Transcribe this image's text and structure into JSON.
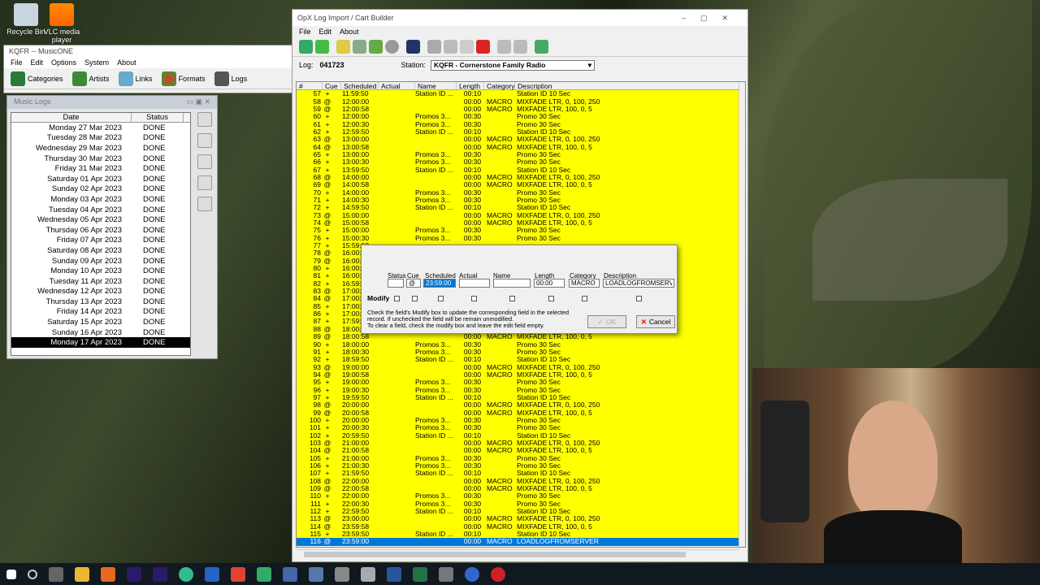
{
  "desktop": {
    "icons": [
      {
        "label": "Recycle Bin",
        "icon": "recycle-bin-icon"
      },
      {
        "label": "VLC media player",
        "icon": "vlc-icon"
      }
    ]
  },
  "musicone": {
    "title": "KQFR -- MusicONE",
    "menu": [
      "File",
      "Edit",
      "Options",
      "System",
      "About"
    ],
    "toolbar": [
      "Categories",
      "Artists",
      "Links",
      "Formats",
      "Logs"
    ]
  },
  "musiclogs": {
    "title": "Music Logs",
    "columns": [
      "Date",
      "Status"
    ],
    "rows": [
      {
        "date": "Monday 27 Mar 2023",
        "status": "DONE"
      },
      {
        "date": "Tuesday 28 Mar 2023",
        "status": "DONE"
      },
      {
        "date": "Wednesday 29 Mar 2023",
        "status": "DONE"
      },
      {
        "date": "Thursday 30 Mar 2023",
        "status": "DONE"
      },
      {
        "date": "Friday 31 Mar 2023",
        "status": "DONE"
      },
      {
        "date": "Saturday 01 Apr 2023",
        "status": "DONE"
      },
      {
        "date": "Sunday 02 Apr 2023",
        "status": "DONE"
      },
      {
        "date": "Monday 03 Apr 2023",
        "status": "DONE"
      },
      {
        "date": "Tuesday 04 Apr 2023",
        "status": "DONE"
      },
      {
        "date": "Wednesday 05 Apr 2023",
        "status": "DONE"
      },
      {
        "date": "Thursday 06 Apr 2023",
        "status": "DONE"
      },
      {
        "date": "Friday 07 Apr 2023",
        "status": "DONE"
      },
      {
        "date": "Saturday 08 Apr 2023",
        "status": "DONE"
      },
      {
        "date": "Sunday 09 Apr 2023",
        "status": "DONE"
      },
      {
        "date": "Monday 10 Apr 2023",
        "status": "DONE"
      },
      {
        "date": "Tuesday 11 Apr 2023",
        "status": "DONE"
      },
      {
        "date": "Wednesday 12 Apr 2023",
        "status": "DONE"
      },
      {
        "date": "Thursday 13 Apr 2023",
        "status": "DONE"
      },
      {
        "date": "Friday 14 Apr 2023",
        "status": "DONE"
      },
      {
        "date": "Saturday 15 Apr 2023",
        "status": "DONE"
      },
      {
        "date": "Sunday 16 Apr 2023",
        "status": "DONE"
      },
      {
        "date": "Monday 17 Apr 2023",
        "status": "DONE"
      }
    ],
    "selected_index": 21
  },
  "opx": {
    "title": "OpX Log Import / Cart Builder",
    "menu": [
      "File",
      "Edit",
      "About"
    ],
    "log_label": "Log:",
    "log_value": "041723",
    "station_label": "Station:",
    "station_value": "KQFR - Cornerstone Family Radio",
    "columns": [
      "#",
      "Cue",
      "Scheduled",
      "Actual",
      "Name",
      "Length",
      "Category",
      "Description"
    ],
    "rows": [
      [
        "57",
        "+",
        "11:59:50",
        "",
        "Station ID ...",
        "00:10",
        "",
        "Station ID 10 Sec"
      ],
      [
        "58",
        "@",
        "12:00:00",
        "",
        "",
        "00:00",
        "MACRO",
        "MIXFADE LTR, 0, 100, 250"
      ],
      [
        "59",
        "@",
        "12:00:58",
        "",
        "",
        "00:00",
        "MACRO",
        "MIXFADE LTR, 100, 0, 5"
      ],
      [
        "60",
        "+",
        "12:00:00",
        "",
        "Promos 3...",
        "00:30",
        "",
        "Promo 30 Sec"
      ],
      [
        "61",
        "+",
        "12:00:30",
        "",
        "Promos 3...",
        "00:30",
        "",
        "Promo 30 Sec"
      ],
      [
        "62",
        "+",
        "12:59:50",
        "",
        "Station ID ...",
        "00:10",
        "",
        "Station ID 10 Sec"
      ],
      [
        "63",
        "@",
        "13:00:00",
        "",
        "",
        "00:00",
        "MACRO",
        "MIXFADE LTR, 0, 100, 250"
      ],
      [
        "64",
        "@",
        "13:00:58",
        "",
        "",
        "00:00",
        "MACRO",
        "MIXFADE LTR, 100, 0, 5"
      ],
      [
        "65",
        "+",
        "13:00:00",
        "",
        "Promos 3...",
        "00:30",
        "",
        "Promo 30 Sec"
      ],
      [
        "66",
        "+",
        "13:00:30",
        "",
        "Promos 3...",
        "00:30",
        "",
        "Promo 30 Sec"
      ],
      [
        "67",
        "+",
        "13:59:50",
        "",
        "Station ID ...",
        "00:10",
        "",
        "Station ID 10 Sec"
      ],
      [
        "68",
        "@",
        "14:00:00",
        "",
        "",
        "00:00",
        "MACRO",
        "MIXFADE LTR, 0, 100, 250"
      ],
      [
        "69",
        "@",
        "14:00:58",
        "",
        "",
        "00:00",
        "MACRO",
        "MIXFADE LTR, 100, 0, 5"
      ],
      [
        "70",
        "+",
        "14:00:00",
        "",
        "Promos 3...",
        "00:30",
        "",
        "Promo 30 Sec"
      ],
      [
        "71",
        "+",
        "14:00:30",
        "",
        "Promos 3...",
        "00:30",
        "",
        "Promo 30 Sec"
      ],
      [
        "72",
        "+",
        "14:59:50",
        "",
        "Station ID ...",
        "00:10",
        "",
        "Station ID 10 Sec"
      ],
      [
        "73",
        "@",
        "15:00:00",
        "",
        "",
        "00:00",
        "MACRO",
        "MIXFADE LTR, 0, 100, 250"
      ],
      [
        "74",
        "@",
        "15:00:58",
        "",
        "",
        "00:00",
        "MACRO",
        "MIXFADE LTR, 100, 0, 5"
      ],
      [
        "75",
        "+",
        "15:00:00",
        "",
        "Promos 3...",
        "00:30",
        "",
        "Promo 30 Sec"
      ],
      [
        "76",
        "+",
        "15:00:30",
        "",
        "Promos 3...",
        "00:30",
        "",
        "Promo 30 Sec"
      ],
      [
        "77",
        "+",
        "15:59:50",
        "",
        "",
        "",
        "",
        ""
      ],
      [
        "78",
        "@",
        "16:00:00",
        "",
        "",
        "",
        "",
        ""
      ],
      [
        "79",
        "@",
        "16:00:58",
        "",
        "",
        "",
        "",
        ""
      ],
      [
        "80",
        "+",
        "16:00:00",
        "",
        "",
        "",
        "",
        ""
      ],
      [
        "81",
        "+",
        "16:00:30",
        "",
        "",
        "",
        "",
        ""
      ],
      [
        "82",
        "+",
        "16:59:50",
        "",
        "",
        "",
        "",
        ""
      ],
      [
        "83",
        "@",
        "17:00:00",
        "",
        "",
        "",
        "",
        ""
      ],
      [
        "84",
        "@",
        "17:00:58",
        "",
        "",
        "",
        "",
        ""
      ],
      [
        "85",
        "+",
        "17:00:00",
        "",
        "",
        "",
        "",
        ""
      ],
      [
        "86",
        "+",
        "17:00:30",
        "",
        "",
        "",
        "",
        ""
      ],
      [
        "87",
        "+",
        "17:59:50",
        "",
        "",
        "",
        "",
        ""
      ],
      [
        "88",
        "@",
        "18:00:00",
        "",
        "",
        "",
        "",
        ""
      ],
      [
        "89",
        "@",
        "18:00:58",
        "",
        "",
        "00:00",
        "MACRO",
        "MIXFADE LTR, 100, 0, 5"
      ],
      [
        "90",
        "+",
        "18:00:00",
        "",
        "Promos 3...",
        "00:30",
        "",
        "Promo 30 Sec"
      ],
      [
        "91",
        "+",
        "18:00:30",
        "",
        "Promos 3...",
        "00:30",
        "",
        "Promo 30 Sec"
      ],
      [
        "92",
        "+",
        "18:59:50",
        "",
        "Station ID ...",
        "00:10",
        "",
        "Station ID 10 Sec"
      ],
      [
        "93",
        "@",
        "19:00:00",
        "",
        "",
        "00:00",
        "MACRO",
        "MIXFADE LTR, 0, 100, 250"
      ],
      [
        "94",
        "@",
        "19:00:58",
        "",
        "",
        "00:00",
        "MACRO",
        "MIXFADE LTR, 100, 0, 5"
      ],
      [
        "95",
        "+",
        "19:00:00",
        "",
        "Promos 3...",
        "00:30",
        "",
        "Promo 30 Sec"
      ],
      [
        "96",
        "+",
        "19:00:30",
        "",
        "Promos 3...",
        "00:30",
        "",
        "Promo 30 Sec"
      ],
      [
        "97",
        "+",
        "19:59:50",
        "",
        "Station ID ...",
        "00:10",
        "",
        "Station ID 10 Sec"
      ],
      [
        "98",
        "@",
        "20:00:00",
        "",
        "",
        "00:00",
        "MACRO",
        "MIXFADE LTR, 0, 100, 250"
      ],
      [
        "99",
        "@",
        "20:00:58",
        "",
        "",
        "00:00",
        "MACRO",
        "MIXFADE LTR, 100, 0, 5"
      ],
      [
        "100",
        "+",
        "20:00:00",
        "",
        "Promos 3...",
        "00:30",
        "",
        "Promo 30 Sec"
      ],
      [
        "101",
        "+",
        "20:00:30",
        "",
        "Promos 3...",
        "00:30",
        "",
        "Promo 30 Sec"
      ],
      [
        "102",
        "+",
        "20:59:50",
        "",
        "Station ID ...",
        "00:10",
        "",
        "Station ID 10 Sec"
      ],
      [
        "103",
        "@",
        "21:00:00",
        "",
        "",
        "00:00",
        "MACRO",
        "MIXFADE LTR, 0, 100, 250"
      ],
      [
        "104",
        "@",
        "21:00:58",
        "",
        "",
        "00:00",
        "MACRO",
        "MIXFADE LTR, 100, 0, 5"
      ],
      [
        "105",
        "+",
        "21:00:00",
        "",
        "Promos 3...",
        "00:30",
        "",
        "Promo 30 Sec"
      ],
      [
        "106",
        "+",
        "21:00:30",
        "",
        "Promos 3...",
        "00:30",
        "",
        "Promo 30 Sec"
      ],
      [
        "107",
        "+",
        "21:59:50",
        "",
        "Station ID ...",
        "00:10",
        "",
        "Station ID 10 Sec"
      ],
      [
        "108",
        "@",
        "22:00:00",
        "",
        "",
        "00:00",
        "MACRO",
        "MIXFADE LTR, 0, 100, 250"
      ],
      [
        "109",
        "@",
        "22:00:58",
        "",
        "",
        "00:00",
        "MACRO",
        "MIXFADE LTR, 100, 0, 5"
      ],
      [
        "110",
        "+",
        "22:00:00",
        "",
        "Promos 3...",
        "00:30",
        "",
        "Promo 30 Sec"
      ],
      [
        "111",
        "+",
        "22:00:30",
        "",
        "Promos 3...",
        "00:30",
        "",
        "Promo 30 Sec"
      ],
      [
        "112",
        "+",
        "22:59:50",
        "",
        "Station ID ...",
        "00:10",
        "",
        "Station ID 10 Sec"
      ],
      [
        "113",
        "@",
        "23:00:00",
        "",
        "",
        "00:00",
        "MACRO",
        "MIXFADE LTR, 0, 100, 250"
      ],
      [
        "114",
        "@",
        "23:59:58",
        "",
        "",
        "00:00",
        "MACRO",
        "MIXFADE LTR, 100, 0, 5"
      ],
      [
        "115",
        "+",
        "23:59:50",
        "",
        "Station ID ...",
        "00:10",
        "",
        "Station ID 10 Sec"
      ],
      [
        "116",
        "@",
        "23:59:00",
        "",
        "",
        "00:00",
        "MACRO",
        "LOADLOGFROMSERVER"
      ]
    ],
    "selected_row": "116"
  },
  "dialog": {
    "headers": [
      "Status",
      "Cue",
      "Scheduled",
      "Actual",
      "Name",
      "Length",
      "Category",
      "Description"
    ],
    "values": {
      "status": "",
      "cue": "@",
      "scheduled": "23:59:00",
      "actual": "",
      "name": "",
      "length": "00:00",
      "category": "MACRO",
      "description": "LOADLOGFROMSERVER"
    },
    "modify_label": "Modify",
    "help_line1": "Check the field's Modify box to update the corresponding field in the selected",
    "help_line2": "record. If unchecked the field will be remain unmodified.",
    "help_line3": "To clear a field, check the modify box and leave the edit field empty.",
    "ok_label": "OK",
    "cancel_label": "Cancel"
  },
  "colors": {
    "row_yellow": "#ffff00",
    "selection_blue": "#0078d7"
  }
}
